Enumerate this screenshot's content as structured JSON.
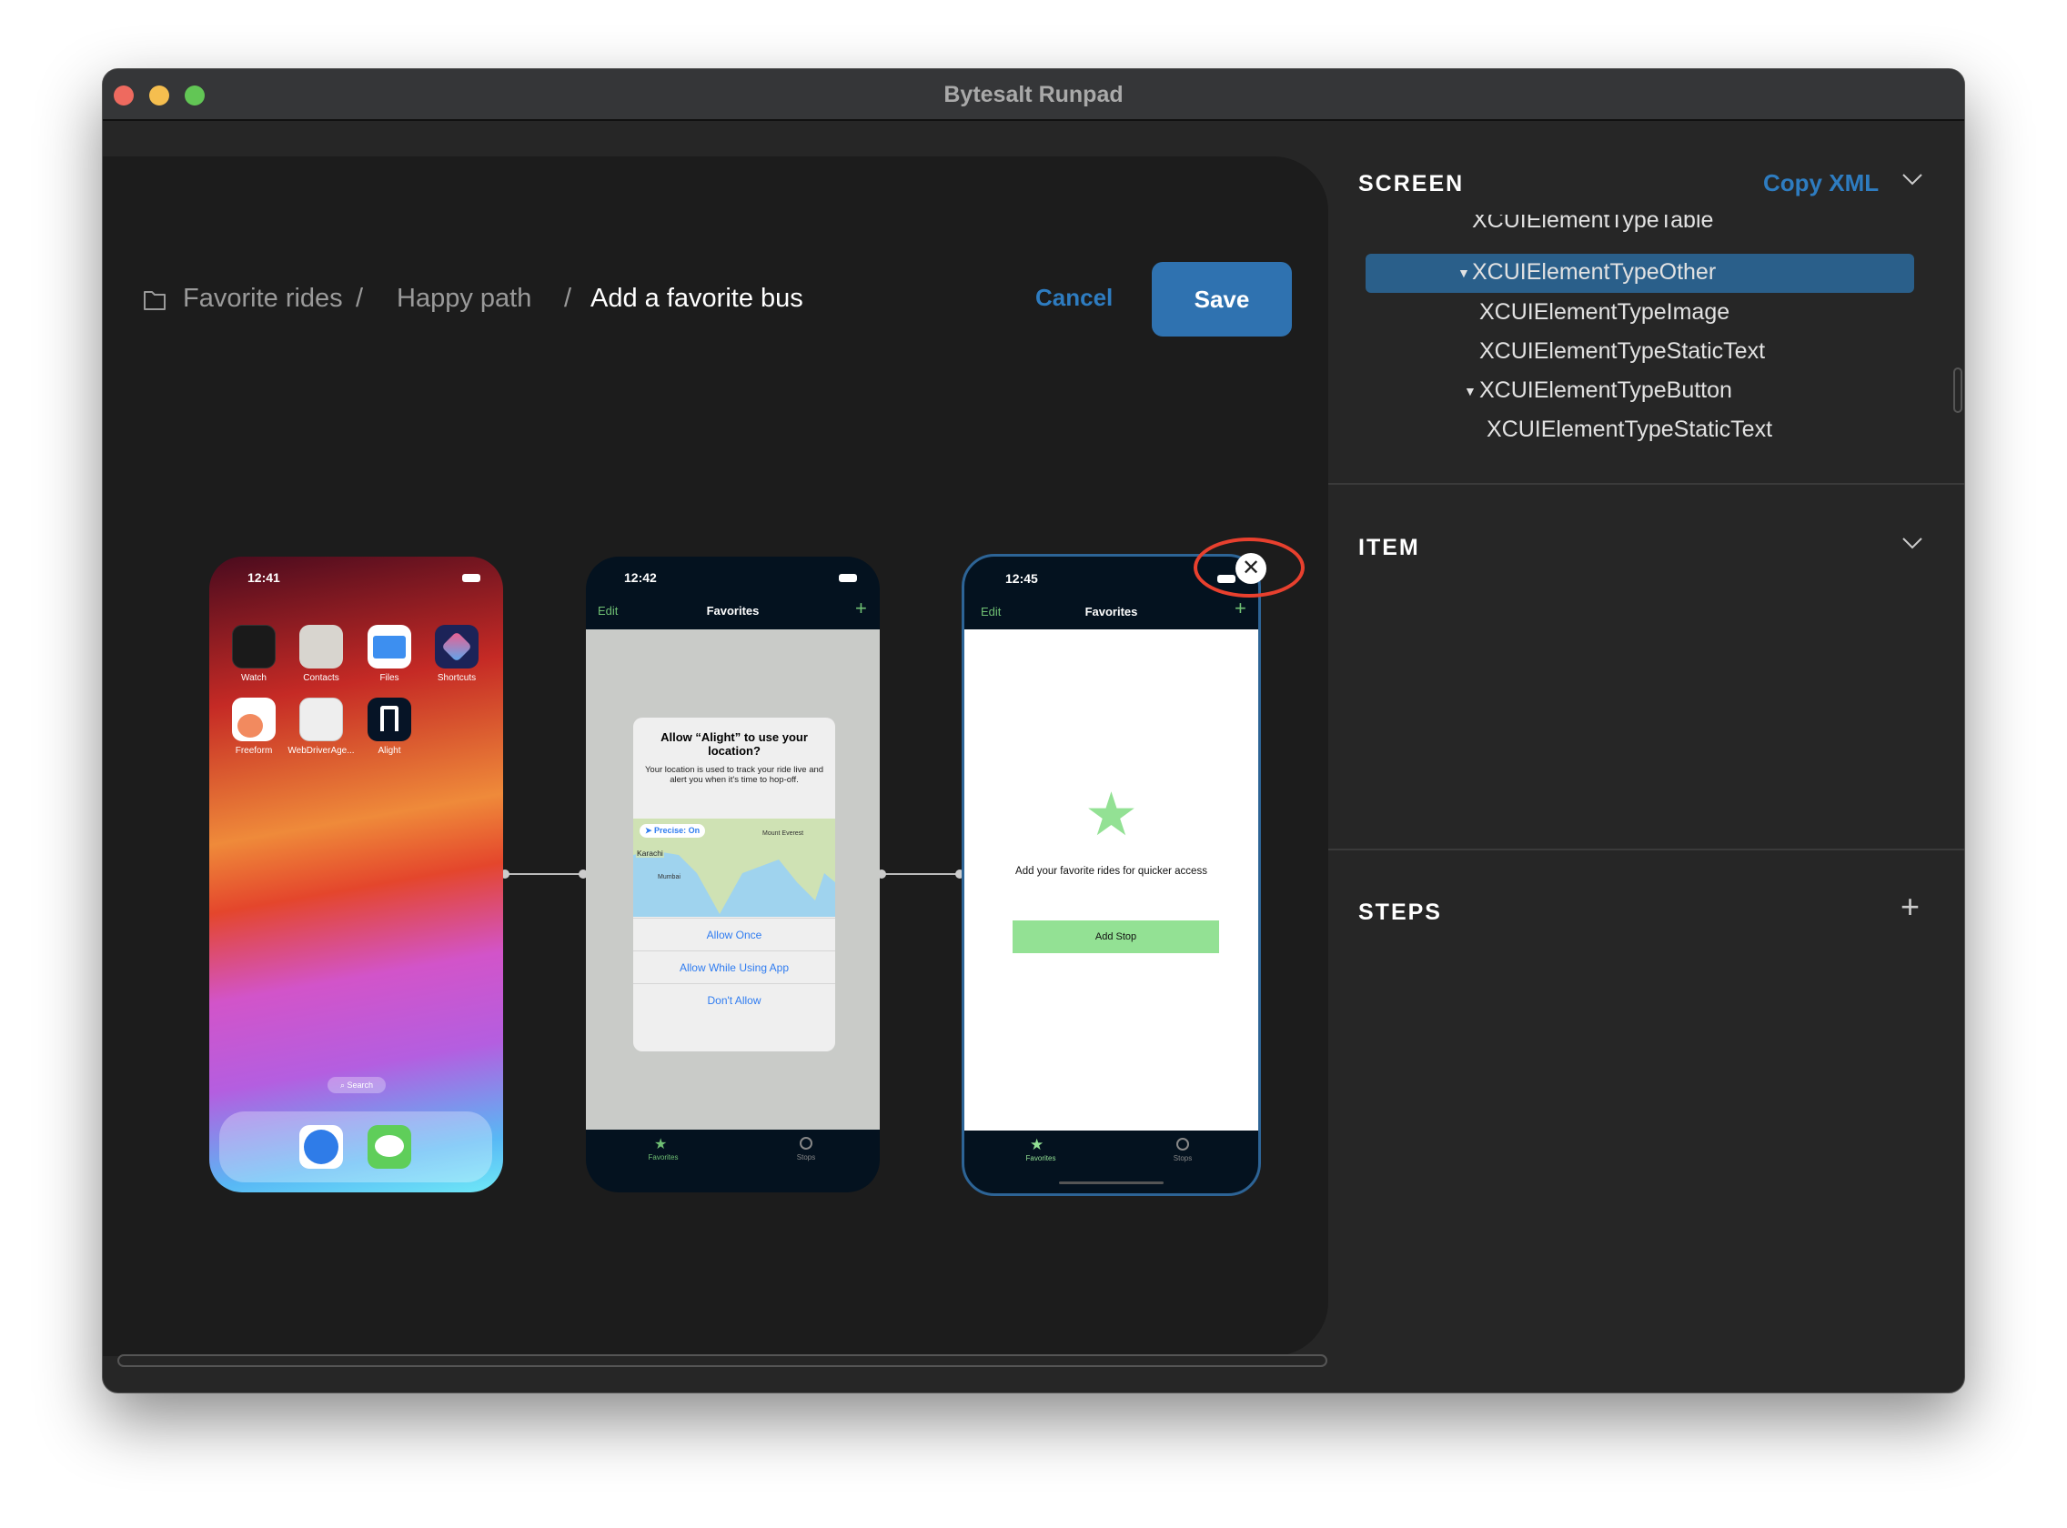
{
  "window": {
    "title": "Bytesalt Runpad"
  },
  "breadcrumb": [
    "Favorite rides",
    "Happy path",
    "Add a favorite bus"
  ],
  "breadcrumb_separator": "/",
  "actions": {
    "cancel": "Cancel",
    "save": "Save"
  },
  "phones": [
    {
      "time": "12:41",
      "apps": [
        "Watch",
        "Contacts",
        "Files",
        "Shortcuts",
        "Freeform",
        "WebDriverAge...",
        "Alight"
      ],
      "search": "Search"
    },
    {
      "time": "12:42",
      "nav": {
        "left": "Edit",
        "title": "Favorites",
        "right": "+"
      },
      "dialog": {
        "title": "Allow “Alight” to use your location?",
        "body": "Your location is used to track your ride live and alert you when it's time to hop-off.",
        "precise": "Precise: On",
        "map_labels": [
          "Mount Everest",
          "Karachi",
          "Mumbai"
        ],
        "buttons": [
          "Allow Once",
          "Allow While Using App",
          "Don't Allow"
        ]
      },
      "tabs": [
        "Favorites",
        "Stops"
      ]
    },
    {
      "time": "12:45",
      "nav": {
        "left": "Edit",
        "title": "Favorites",
        "right": "+"
      },
      "message": "Add your favorite rides for quicker access",
      "button": "Add Stop",
      "tabs": [
        "Favorites",
        "Stops"
      ],
      "selected": true
    }
  ],
  "screen": {
    "heading": "SCREEN",
    "copy_xml": "Copy XML",
    "tree": [
      {
        "label": "XCUIElementTypeTable"
      },
      {
        "label": "XCUIElementTypeOther",
        "expanded": true,
        "selected": true
      },
      {
        "label": "XCUIElementTypeImage"
      },
      {
        "label": "XCUIElementTypeStaticText"
      },
      {
        "label": "XCUIElementTypeButton",
        "expanded": true
      },
      {
        "label": "XCUIElementTypeStaticText"
      }
    ]
  },
  "item": {
    "heading": "ITEM"
  },
  "steps": {
    "heading": "STEPS",
    "add": "+"
  },
  "colors": {
    "accent": "#2e7cc0",
    "selected_row": "#2a5f8a",
    "app_green": "#93e194",
    "annotation": "#e8402e"
  }
}
